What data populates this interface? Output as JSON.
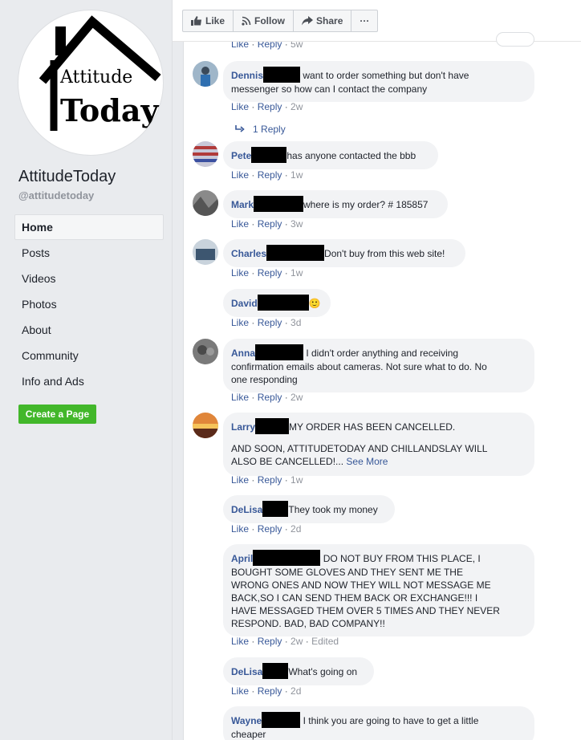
{
  "sidebar": {
    "page_name": "AttitudeToday",
    "handle": "@attitudetoday",
    "logo_text_top": "Attitude",
    "logo_text_bottom": "Today",
    "nav": [
      "Home",
      "Posts",
      "Videos",
      "Photos",
      "About",
      "Community",
      "Info and Ads"
    ],
    "create_page": "Create a Page"
  },
  "toolbar": {
    "like": "Like",
    "follow": "Follow",
    "share": "Share",
    "more": "···"
  },
  "top_meta": {
    "like": "Like",
    "reply": "Reply",
    "time": "5w"
  },
  "comments": [
    {
      "name": "Dennis",
      "text_l1": "want to order something but don't have",
      "text_l2": "messenger so how can I contact the company",
      "like": "Like",
      "reply": "Reply",
      "time": "2w"
    },
    {
      "name": "Pete",
      "text": "has anyone contacted the bbb",
      "like": "Like",
      "reply": "Reply",
      "time": "1w"
    },
    {
      "name": "Mark",
      "text": "where is my order? # 185857",
      "like": "Like",
      "reply": "Reply",
      "time": "3w"
    },
    {
      "name": "Charles",
      "text": "Don't buy from this web site!",
      "like": "Like",
      "reply": "Reply",
      "time": "1w"
    },
    {
      "name": "David",
      "emoji": "🙂",
      "like": "Like",
      "reply": "Reply",
      "time": "3d"
    },
    {
      "name": "Anna",
      "text_l1": "I didn't order anything and receiving",
      "text_l2": "confirmation emails about cameras. Not sure what to do. No",
      "text_l3": "one responding",
      "like": "Like",
      "reply": "Reply",
      "time": "2w"
    },
    {
      "name": "Larry",
      "text_l1": "MY ORDER HAS BEEN CANCELLED.",
      "text_l2": "AND SOON, ATTITUDETODAY AND CHILLANDSLAY WILL",
      "text_l3": "ALSO BE CANCELLED!...",
      "see_more": "See More",
      "like": "Like",
      "reply": "Reply",
      "time": "1w"
    },
    {
      "name": "DeLisa",
      "text": "They took my money",
      "like": "Like",
      "reply": "Reply",
      "time": "2d"
    },
    {
      "name": "April",
      "text_l1": "DO NOT BUY FROM THIS PLACE, I",
      "text_l2": "BOUGHT SOME GLOVES AND THEY SENT ME THE",
      "text_l3": "WRONG ONES AND NOW THEY WILL NOT MESSAGE ME",
      "text_l4": "BACK,SO I CAN SEND THEM BACK OR EXCHANGE!!! I",
      "text_l5": "HAVE MESSAGED THEM OVER 5 TIMES AND THEY NEVER",
      "text_l6": "RESPOND. BAD, BAD COMPANY!!",
      "like": "Like",
      "reply": "Reply",
      "time": "2w",
      "edited": "Edited"
    },
    {
      "name": "DeLisa",
      "text": "What's going on",
      "like": "Like",
      "reply": "Reply",
      "time": "2d"
    },
    {
      "name": "Wayne",
      "text_l1": "I think you are going to have to get a little",
      "text_l2": "cheaper"
    }
  ],
  "replies_link": "1 Reply",
  "colors": {
    "link": "#385898",
    "green": "#42b72a",
    "bubble": "#f2f3f5"
  }
}
